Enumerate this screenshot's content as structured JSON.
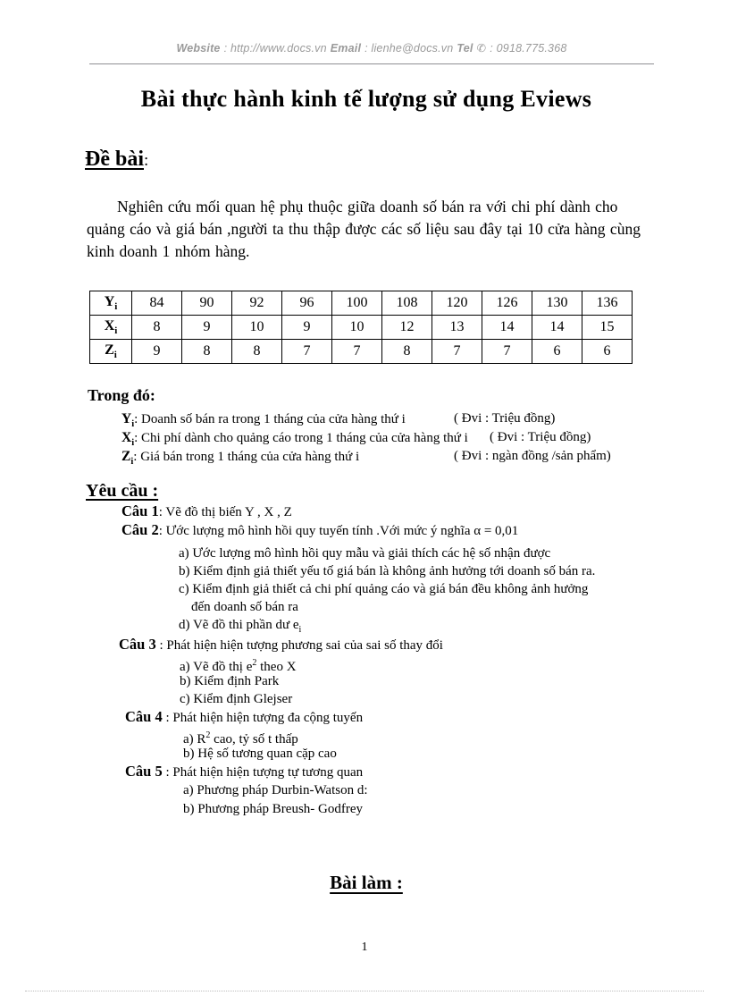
{
  "header": {
    "website_label": "Website",
    "website_value": ": http://www.docs.vn",
    "email_label": "Email",
    "email_value": ": lienhe@docs.vn",
    "tel_label": "Tel",
    "tel_icon": "telephone-icon",
    "tel_value": ": 0918.775.368"
  },
  "title": "Bài thực hành kinh tế lượng sử dụng Eviews",
  "de_bai": {
    "label": "Đề bài",
    "colon": ":"
  },
  "intro": "Nghiên cứu mối quan hệ phụ thuộc giữa doanh số bán ra với chi phí dành cho quảng cáo và giá bán ,người ta thu thập được các số liệu sau đây tại 10 cửa hàng cùng kinh doanh 1 nhóm hàng.",
  "chart_data": {
    "type": "table",
    "title": "",
    "row_labels": [
      "Y",
      "X",
      "Z"
    ],
    "row_label_sub": "i",
    "series": [
      {
        "name": "Yi",
        "values": [
          84,
          90,
          92,
          96,
          100,
          108,
          120,
          126,
          130,
          136
        ]
      },
      {
        "name": "Xi",
        "values": [
          8,
          9,
          10,
          9,
          10,
          12,
          13,
          14,
          14,
          15
        ]
      },
      {
        "name": "Zi",
        "values": [
          9,
          8,
          8,
          7,
          7,
          8,
          7,
          7,
          6,
          6
        ]
      }
    ],
    "n_observations": 10
  },
  "trong_do": {
    "title": "Trong đó:",
    "definitions": [
      {
        "symbol": "Y",
        "sub": "i",
        "sep": ":",
        "text": "Doanh số bán ra trong 1 tháng của cửa hàng thứ i",
        "unit": "( Đvi : Triệu đồng)"
      },
      {
        "symbol": "X",
        "sub": "i",
        "sep": ":",
        "text": "Chi phí dành cho quảng cáo trong 1 tháng của cửa hàng thứ i",
        "unit": "( Đvi : Triệu đồng)"
      },
      {
        "symbol": "Z",
        "sub": "i",
        "sep": ":",
        "text": "Giá bán trong 1 tháng của cửa hàng thứ i",
        "unit": "( Đvi : ngàn đồng /sản phẩm)"
      }
    ]
  },
  "yeu_cau": {
    "title": "Yêu cầu :",
    "items": [
      {
        "label": "Câu 1",
        "sep": ":",
        "text": "Vẽ đồ thị biến Y , X , Z",
        "subs": []
      },
      {
        "label": "Câu 2",
        "sep": ":",
        "text": "Ước lượng mô hình hồi quy tuyến tính .Với mức ý nghĩa   α = 0,01",
        "subs": [
          "a) Ước lượng mô hình hồi quy mẫu và giải thích các hệ số nhận được",
          "b) Kiểm định giả thiết yếu tố giá bán là không ảnh hưởng tới doanh số bán ra.",
          "c) Kiểm định giả thiết cả chi phí quảng cáo và giá bán đều không ảnh hưởng",
          "đến doanh số bán ra",
          "d) Vẽ đồ thi phần dư e"
        ]
      },
      {
        "label": "Câu 3",
        "sep": ":",
        "text": "Phát hiện hiện tượng phương sai của sai số thay đổi",
        "subs": [
          "a) Vẽ đồ thị e",
          "b) Kiểm định Park",
          "c) Kiểm định Glejser"
        ]
      },
      {
        "label": "Câu 4",
        "sep": ":",
        "text": "Phát hiện hiện tượng đa cộng tuyến",
        "subs": [
          "a) R",
          "b) Hệ số tương quan cặp cao"
        ]
      },
      {
        "label": "Câu 5",
        "sep": ":",
        "text": "Phát hiện hiện tượng tự tương quan",
        "subs": [
          "a) Phương pháp Durbin-Watson  d:",
          "b) Phương pháp Breush-  Godfrey"
        ]
      }
    ],
    "inline_math": {
      "residual_sub": "i",
      "e_squared_exp": "2",
      "e_squared_suffix": " theo X",
      "r_squared_exp": "2",
      "r_squared_suffix": " cao, tỷ số t thấp"
    }
  },
  "bai_lam": "Bài làm :",
  "page_number": "1"
}
